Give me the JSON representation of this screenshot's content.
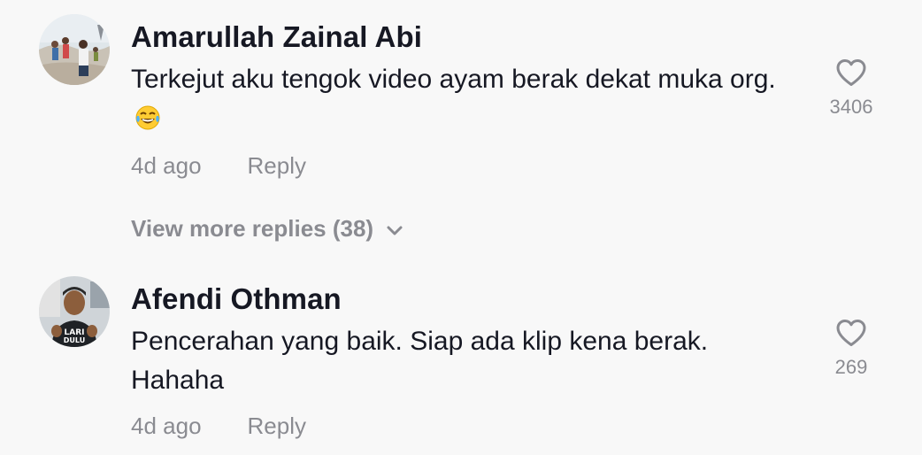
{
  "comments": [
    {
      "username": "Amarullah Zainal Abi",
      "text": "Terkejut aku tengok video ayam berak dekat muka org.",
      "emoji": "laughing-tears-emoji",
      "time": "4d ago",
      "reply_label": "Reply",
      "likes": "3406"
    },
    {
      "username": "Afendi Othman",
      "text": "Pencerahan yang baik. Siap ada klip kena berak. Hahaha",
      "time": "4d ago",
      "reply_label": "Reply",
      "likes": "269"
    }
  ],
  "view_more": {
    "label": "View more replies (38)",
    "icon": "chevron-down-icon"
  },
  "colors": {
    "background": "#f8f8f8",
    "primary_text": "#161823",
    "secondary_text": "#8a8b91"
  }
}
